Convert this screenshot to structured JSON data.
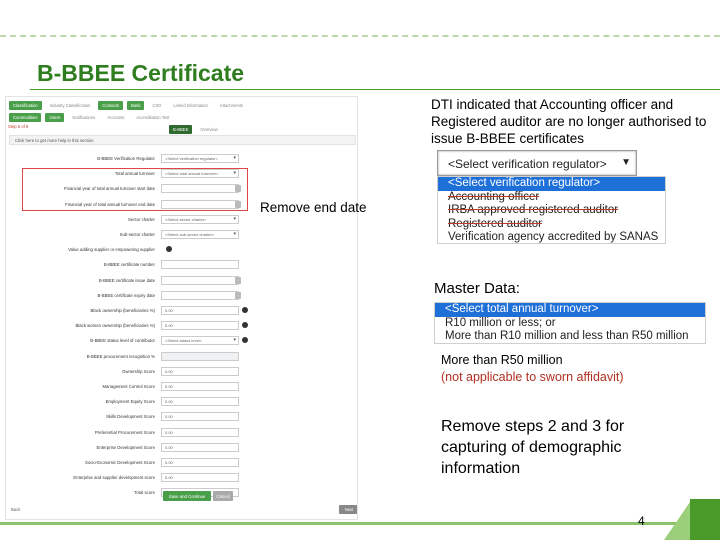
{
  "slide": {
    "title": "B-BBEE Certificate",
    "page_number": "4"
  },
  "annotations": {
    "dti_note": "DTI indicated that Accounting officer and Registered auditor are no longer authorised to issue B-BBEE certificates",
    "remove_end_date": "Remove end date",
    "master_data": "Master Data:",
    "r50_line1": "More than R50 million",
    "r50_line2": "(not applicable to sworn affidavit)",
    "remove_steps": "Remove steps 2 and 3 for capturing of demographic information"
  },
  "verification_select": {
    "value": "<Select verification regulator>",
    "options": [
      "<Select verification regulator>",
      "Accounting officer",
      "IRBA approved registered auditor",
      "Registered auditor",
      "Verification agency accredited by SANAS"
    ],
    "struck_options": [
      1,
      2,
      3
    ]
  },
  "turnover_select": {
    "options": [
      "<Select total annual turnover>",
      "R10 million or less; or",
      "More than R10 million and less than R50 million"
    ]
  },
  "form": {
    "step_label": "Step 5 of 9",
    "hint": "Click here to get more help in this section",
    "nav_row1": [
      "Classification",
      "Industry Classification",
      "Contacts",
      "Bank",
      "CSD",
      "Linked Information",
      "Attachments"
    ],
    "nav_row2": [
      "Commodities",
      "Users",
      "Notifications",
      "Accounts",
      "Accreditation Test"
    ],
    "nav_row3": [
      "B-BBEE",
      "Overview"
    ],
    "fields": [
      {
        "label": "B-BBEE Verification Regulator",
        "value": "<Select verification regulator>",
        "kind": "dropdown"
      },
      {
        "label": "Total annual turnover",
        "value": "<Select total annual turnover>",
        "kind": "dropdown"
      },
      {
        "label": "Financial year of total annual turnover start date",
        "value": "",
        "kind": "date"
      },
      {
        "label": "Financial year of total annual turnover end date",
        "value": "",
        "kind": "date"
      },
      {
        "label": "Sector charter",
        "value": "<Select sector charter>",
        "kind": "dropdown"
      },
      {
        "label": "Sub-sector charter",
        "value": "<Select sub-sector charter>",
        "kind": "dropdown"
      },
      {
        "label": "Value adding supplier or empowering supplier",
        "value": "",
        "kind": "check"
      },
      {
        "label": "B-BBEE certificate number",
        "value": "",
        "kind": "text"
      },
      {
        "label": "B-BBEE certificate issue date",
        "value": "",
        "kind": "date"
      },
      {
        "label": "B-BBEE certificate expiry date",
        "value": "",
        "kind": "date"
      },
      {
        "label": "Black ownership (beneficiaries %)",
        "value": "0.00",
        "kind": "info"
      },
      {
        "label": "Black women ownership (beneficiaries %)",
        "value": "0.00",
        "kind": "info"
      },
      {
        "label": "B-BBEE status level of contributor",
        "value": "<Select status level>",
        "kind": "dropdown-info"
      },
      {
        "label": "B-BBEE procurement recognition %",
        "value": "",
        "kind": "readonly"
      },
      {
        "label": "Ownership Score",
        "value": "0.00",
        "kind": "text"
      },
      {
        "label": "Management Control Score",
        "value": "0.00",
        "kind": "text"
      },
      {
        "label": "Employment Equity Score",
        "value": "0.00",
        "kind": "text"
      },
      {
        "label": "Skills Development Score",
        "value": "0.00",
        "kind": "text"
      },
      {
        "label": "Preferential Procurement Score",
        "value": "0.00",
        "kind": "text"
      },
      {
        "label": "Enterprise Development Score",
        "value": "0.00",
        "kind": "text"
      },
      {
        "label": "Socio-Economic Development Score",
        "value": "0.00",
        "kind": "text"
      },
      {
        "label": "Enterprise and supplier development score",
        "value": "0.00",
        "kind": "text"
      },
      {
        "label": "Total score",
        "value": "",
        "kind": "text"
      }
    ],
    "save_label": "Save and Continue",
    "cancel_label": "Cancel",
    "back_label": "Back",
    "next_label": "Next"
  },
  "colors": {
    "title_green": "#2e7d1f",
    "select_highlight": "#1e6fd8",
    "strike_red": "#c0392b"
  }
}
